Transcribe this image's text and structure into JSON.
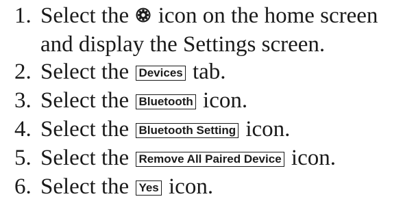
{
  "steps": [
    {
      "number": "1.",
      "before": "Select the",
      "icon": "gear-icon",
      "after": "icon on the home screen",
      "line2": "and display the Settings screen."
    },
    {
      "number": "2.",
      "before": "Select the",
      "button": "Devices",
      "after": "tab."
    },
    {
      "number": "3.",
      "before": "Select the",
      "button": "Bluetooth",
      "after": "icon."
    },
    {
      "number": "4.",
      "before": "Select the",
      "button": "Bluetooth Setting",
      "after": "icon."
    },
    {
      "number": "5.",
      "before": "Select the",
      "button": "Remove All Paired Device",
      "after": "icon."
    },
    {
      "number": "6.",
      "before": "Select the",
      "button": "Yes",
      "after": "icon."
    }
  ]
}
